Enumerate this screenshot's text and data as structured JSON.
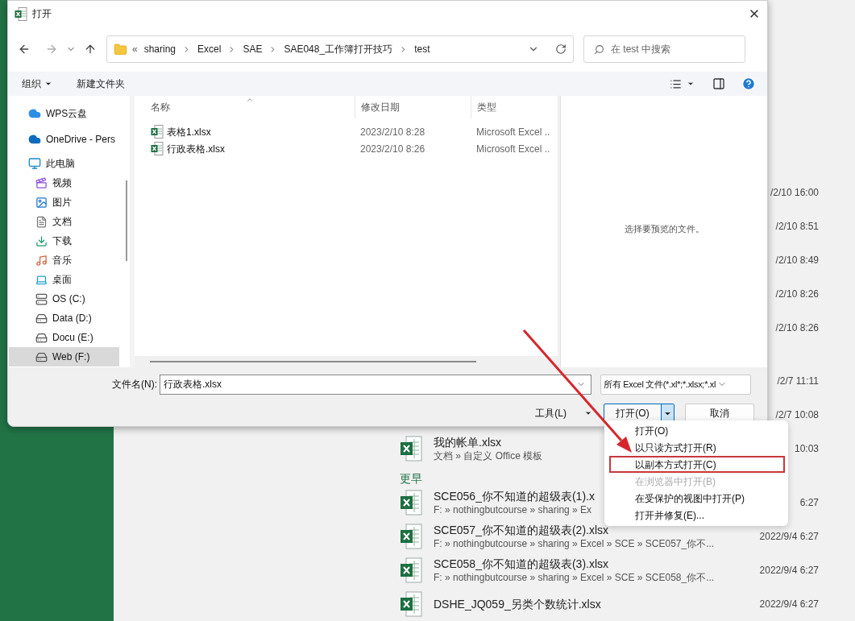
{
  "dialog": {
    "title": "打开",
    "address": {
      "overflow_marker": "«",
      "segments": [
        "sharing",
        "Excel",
        "SAE",
        "SAE048_工作簿打开技巧",
        "test"
      ]
    },
    "search": {
      "placeholder": "在 test 中搜索"
    },
    "toolbar": {
      "organize": "组织",
      "new_folder": "新建文件夹"
    },
    "nav_pane": [
      {
        "label": "WPS云盘",
        "kind": "wps",
        "selected": false
      },
      {
        "label": "OneDrive - Pers",
        "kind": "onedrive",
        "selected": false
      },
      {
        "label": "此电脑",
        "kind": "pc",
        "selected": false,
        "children": [
          {
            "label": "视频",
            "kind": "video",
            "selected": false
          },
          {
            "label": "图片",
            "kind": "pictures",
            "selected": false
          },
          {
            "label": "文档",
            "kind": "documents",
            "selected": false
          },
          {
            "label": "下载",
            "kind": "downloads",
            "selected": false
          },
          {
            "label": "音乐",
            "kind": "music",
            "selected": false
          },
          {
            "label": "桌面",
            "kind": "desktop",
            "selected": false
          },
          {
            "label": "OS (C:)",
            "kind": "system-drive",
            "selected": false
          },
          {
            "label": "Data (D:)",
            "kind": "drive",
            "selected": false
          },
          {
            "label": "Docu (E:)",
            "kind": "drive",
            "selected": false
          },
          {
            "label": "Web (F:)",
            "kind": "drive",
            "selected": true
          }
        ]
      }
    ],
    "columns": [
      "名称",
      "修改日期",
      "类型"
    ],
    "files": [
      {
        "name": "表格1.xlsx",
        "modified": "2023/2/10 8:28",
        "type": "Microsoft Excel .."
      },
      {
        "name": "行政表格.xlsx",
        "modified": "2023/2/10 8:26",
        "type": "Microsoft Excel .."
      }
    ],
    "preview_hint": "选择要预览的文件。",
    "file_name_label": "文件名(N):",
    "file_name": "行政表格.xlsx",
    "file_type": "所有 Excel 文件(*.xl*;*.xlsx;*.xl",
    "tools": "工具(L)",
    "open": "打开(O)",
    "open_menu_expanded": true,
    "cancel": "取消"
  },
  "open_menu": [
    {
      "label": "打开(O)",
      "disabled": false,
      "highlighted": false
    },
    {
      "label": "以只读方式打开(R)",
      "disabled": false,
      "highlighted": false
    },
    {
      "label": "以副本方式打开(C)",
      "disabled": false,
      "highlighted": true
    },
    {
      "label": "在浏览器中打开(B)",
      "disabled": true,
      "highlighted": false
    },
    {
      "label": "在受保护的视图中打开(P)",
      "disabled": false,
      "highlighted": false
    },
    {
      "label": "打开并修复(E)...",
      "disabled": false,
      "highlighted": false
    }
  ],
  "background": {
    "recent_dates": [
      "/2/10 16:00",
      "/2/10 8:51",
      "/2/10 8:49",
      "/2/10 8:26",
      "/2/10 8:26"
    ],
    "earlier_dates": [
      "/2/7 11:11",
      "/2/7 10:08"
    ],
    "rows": [
      {
        "name": "我的帐单.xlsx",
        "path": "文档 » 自定义 Office 模板",
        "date": "10:03"
      }
    ],
    "group_heading": "更早",
    "older_rows": [
      {
        "name": "SCE056_你不知道的超级表(1).x",
        "path": "F: » nothingbutcourse » sharing » Ex",
        "date": "6:27"
      },
      {
        "name": "SCE057_你不知道的超级表(2).xlsx",
        "path": "F: » nothingbutcourse » sharing » Excel » SCE » SCE057_你不...",
        "date": "2022/9/4 6:27"
      },
      {
        "name": "SCE058_你不知道的超级表(3).xlsx",
        "path": "F: » nothingbutcourse » sharing » Excel » SCE » SCE058_你不...",
        "date": "2022/9/4 6:27"
      },
      {
        "name": "DSHE_JQ059_另类个数统计.xlsx",
        "date": "2022/9/4 6:27"
      }
    ]
  }
}
